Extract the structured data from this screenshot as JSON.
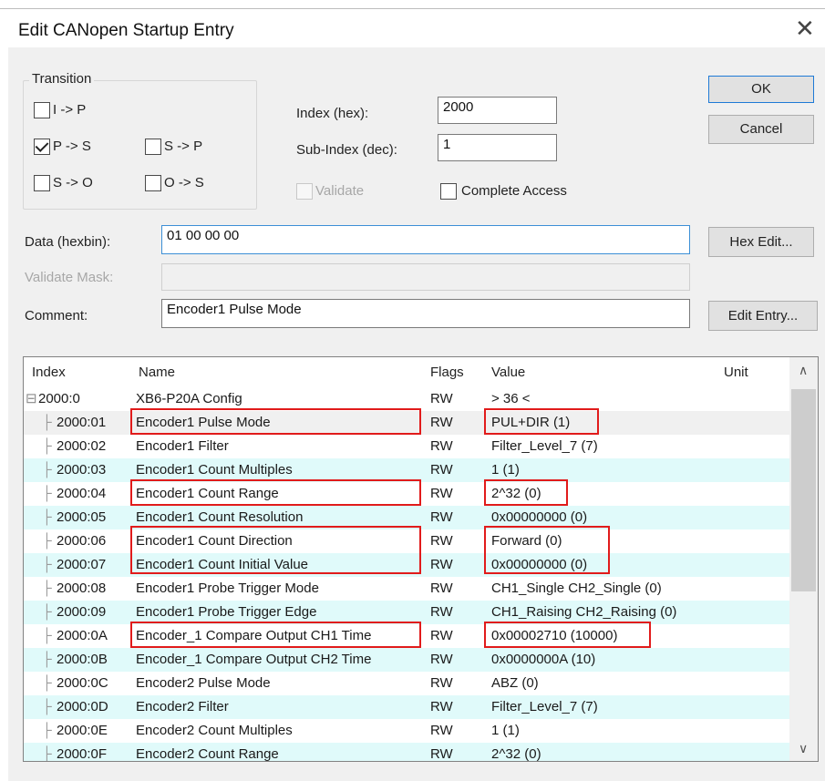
{
  "window": {
    "title": "Edit CANopen Startup Entry",
    "close_symbol": "✕"
  },
  "transition": {
    "group_label": "Transition",
    "options": [
      {
        "label": "I -> P",
        "checked": false
      },
      {
        "label": "P -> S",
        "checked": true
      },
      {
        "label": "S -> P",
        "checked": false
      },
      {
        "label": "S -> O",
        "checked": false
      },
      {
        "label": "O -> S",
        "checked": false
      }
    ]
  },
  "fields": {
    "index_label": "Index (hex):",
    "index_value": "2000",
    "subindex_label": "Sub-Index (dec):",
    "subindex_value": "1",
    "validate_label": "Validate",
    "complete_access_label": "Complete Access",
    "data_label": "Data (hexbin):",
    "data_value": "01 00 00 00",
    "validate_mask_label": "Validate Mask:",
    "validate_mask_value": "",
    "comment_label": "Comment:",
    "comment_value": "Encoder1 Pulse Mode"
  },
  "buttons": {
    "ok": "OK",
    "cancel": "Cancel",
    "hex_edit": "Hex Edit...",
    "edit_entry": "Edit Entry..."
  },
  "table": {
    "columns": [
      "Index",
      "Name",
      "Flags",
      "Value",
      "Unit"
    ],
    "rows": [
      {
        "index": "2000:0",
        "name": "XB6-P20A Config",
        "flags": "RW",
        "value": "> 36 <"
      },
      {
        "index": "2000:01",
        "name": "Encoder1 Pulse Mode",
        "flags": "RW",
        "value": "PUL+DIR (1)"
      },
      {
        "index": "2000:02",
        "name": "Encoder1 Filter",
        "flags": "RW",
        "value": "Filter_Level_7 (7)"
      },
      {
        "index": "2000:03",
        "name": "Encoder1 Count Multiples",
        "flags": "RW",
        "value": "1 (1)"
      },
      {
        "index": "2000:04",
        "name": "Encoder1 Count Range",
        "flags": "RW",
        "value": "2^32 (0)"
      },
      {
        "index": "2000:05",
        "name": "Encoder1 Count Resolution",
        "flags": "RW",
        "value": "0x00000000 (0)"
      },
      {
        "index": "2000:06",
        "name": "Encoder1 Count Direction",
        "flags": "RW",
        "value": "Forward (0)"
      },
      {
        "index": "2000:07",
        "name": "Encoder1 Count Initial Value",
        "flags": "RW",
        "value": "0x00000000 (0)"
      },
      {
        "index": "2000:08",
        "name": "Encoder1 Probe Trigger Mode",
        "flags": "RW",
        "value": "CH1_Single CH2_Single (0)"
      },
      {
        "index": "2000:09",
        "name": "Encoder1 Probe Trigger Edge",
        "flags": "RW",
        "value": "CH1_Raising CH2_Raising (0)"
      },
      {
        "index": "2000:0A",
        "name": "Encoder_1 Compare Output CH1 Time",
        "flags": "RW",
        "value": "0x00002710 (10000)"
      },
      {
        "index": "2000:0B",
        "name": "Encoder_1 Compare Output CH2 Time",
        "flags": "RW",
        "value": "0x0000000A (10)"
      },
      {
        "index": "2000:0C",
        "name": "Encoder2 Pulse Mode",
        "flags": "RW",
        "value": "ABZ (0)"
      },
      {
        "index": "2000:0D",
        "name": "Encoder2 Filter",
        "flags": "RW",
        "value": "Filter_Level_7 (7)"
      },
      {
        "index": "2000:0E",
        "name": "Encoder2 Count Multiples",
        "flags": "RW",
        "value": "1 (1)"
      },
      {
        "index": "2000:0F",
        "name": "Encoder2 Count Range",
        "flags": "RW",
        "value": "2^32 (0)"
      }
    ]
  },
  "scrollbar": {
    "up_symbol": "∧",
    "down_symbol": "∨"
  },
  "colors": {
    "highlight_row": "#e0fafa",
    "annotation_box": "#e11b1b",
    "focus_border": "#3c8fd6"
  }
}
